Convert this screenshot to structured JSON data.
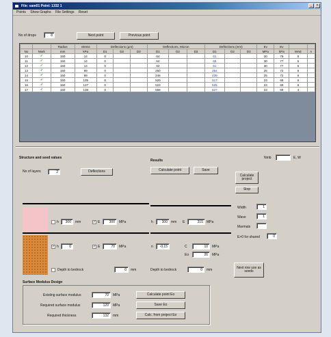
{
  "window": {
    "title": "File: sam01   Point: 1332 1"
  },
  "menu": [
    "Points",
    "Show Graphs",
    "File Settings",
    "Reset"
  ],
  "top": {
    "drops_label": "No of drops",
    "drops_value": "8",
    "next_label": "Next point",
    "prev_label": "Previous point"
  },
  "table": {
    "headers1": [
      "",
      "",
      "Radius",
      "Stress",
      "Deflections (µm)",
      "Deflections, Micron",
      "Deflections (mm)",
      "Ev",
      "Ev",
      "",
      "",
      ""
    ],
    "headers2": [
      "No",
      "Mark",
      "mm",
      "kPa",
      "D1",
      "D2",
      "D3",
      "D1",
      "D2",
      "D3",
      "D1",
      "D2",
      "D3",
      "MPa",
      "kPa",
      "MAE",
      "n"
    ],
    "rows": [
      [
        "10",
        "✓",
        "150",
        "14",
        "0",
        "",
        "",
        "64",
        "",
        "",
        "61",
        "",
        "",
        "30",
        "79",
        "5",
        ""
      ],
      [
        "11",
        "✓",
        "150",
        "14",
        "0",
        "",
        "",
        "64",
        "",
        "",
        "65",
        "",
        "",
        "30",
        "77",
        "5",
        ""
      ],
      [
        "12",
        "✓",
        "150",
        "14",
        "0",
        "",
        "",
        "63",
        "",
        "",
        "61",
        "",
        "",
        "30",
        "77",
        "5",
        ""
      ],
      [
        "13",
        "✓",
        "150",
        "89",
        "0",
        "",
        "",
        "250",
        "",
        "",
        "254",
        "",
        "",
        "25",
        "72",
        "6",
        ""
      ],
      [
        "14",
        "✓",
        "150",
        "89",
        "0",
        "",
        "",
        "246",
        "",
        "",
        "239",
        "",
        "",
        "25",
        "72",
        "6",
        ""
      ],
      [
        "15",
        "✓",
        "150",
        "135",
        "0",
        "",
        "",
        "520",
        "",
        "",
        "517",
        "",
        "",
        "23",
        "69",
        "6",
        ""
      ],
      [
        "16",
        "✓",
        "150",
        "137",
        "0",
        "",
        "",
        "523",
        "",
        "",
        "525",
        "",
        "",
        "23",
        "69",
        "6",
        ""
      ],
      [
        "17",
        "✓",
        "150",
        "138",
        "0",
        "",
        "",
        "558",
        "",
        "",
        "527",
        "",
        "",
        "23",
        "69",
        "4",
        ""
      ]
    ]
  },
  "structure": {
    "title": "Structure and seed values",
    "layers_label": "No of layers",
    "layers_value": "2",
    "deflections_label": "Deflections",
    "h1_value": "300",
    "h1_unit": "mm",
    "e1_value": "300",
    "e1_unit": "MPa",
    "h2_value": "0",
    "e2_value": "70",
    "e2_unit": "MPa",
    "depth_label": "Depth to bedrock",
    "depth_value": "0",
    "depth_unit": "mm"
  },
  "results": {
    "title": "Results",
    "calc_label": "Calculate point",
    "save_label": "Save",
    "h_label": "h",
    "h_value": "300",
    "h_unit": "mm",
    "e_value": "315",
    "e_unit": "MPa",
    "n_value": "-0.15",
    "c_label": "C",
    "c_value": "10",
    "c_unit": "MPa",
    "eo_label": "Eo",
    "eo_value": "26",
    "eo_unit": "MPa",
    "depth_label": "Depth to bedrock",
    "depth_value": "0",
    "depth_unit": "mm"
  },
  "right": {
    "nmb_label": "Nmb",
    "nmb_value": "",
    "nmb_unit": "E, W",
    "calc_proj_label": "Calculate project",
    "stop_label": "Stop",
    "width_label": "Width",
    "width_value": "1",
    "wave_label": "Wave",
    "wave_value": "1",
    "marmals_label": "Marmals",
    "marmals_value": "",
    "ed_label": "E>0 for shared",
    "ed_value": "0",
    "next_row_label": "Next row use as seeds"
  },
  "surface": {
    "title": "Surface Modulus Design",
    "existing_label": "Existing surface modulus",
    "existing_value": "70",
    "existing_unit": "MPa",
    "required_label": "Required surface modulus",
    "required_value": "120",
    "required_unit": "MPa",
    "thickness_label": "Required thickness",
    "thickness_value": "132",
    "thickness_unit": "mm",
    "btn1": "Calculate point Eo",
    "btn2": "Save Eo",
    "btn3": "Calc. from project Eo"
  }
}
